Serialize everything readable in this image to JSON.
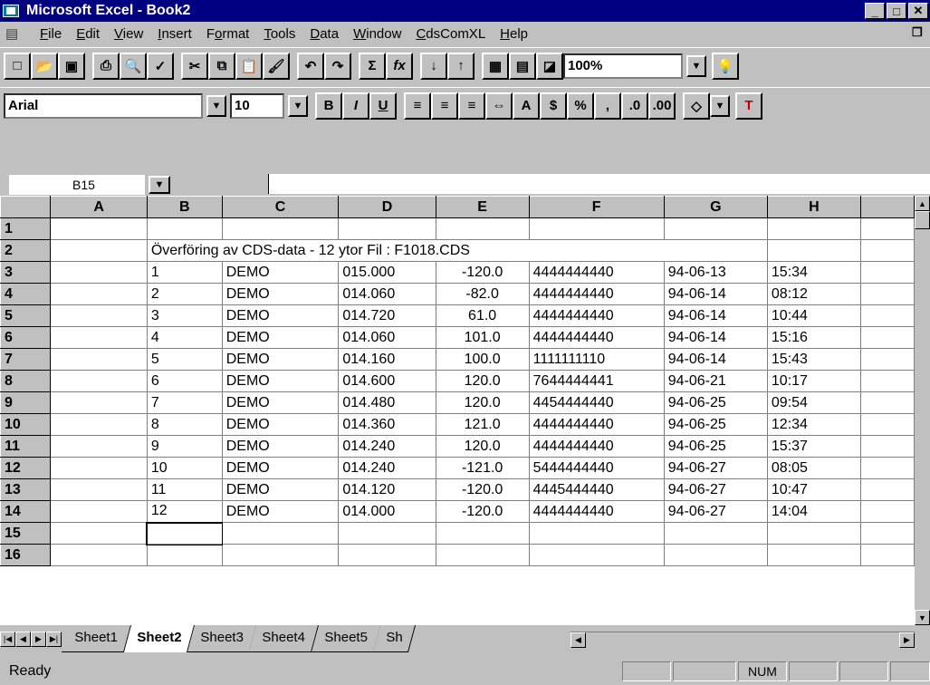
{
  "window": {
    "title": "Microsoft Excel - Book2",
    "buttons": [
      "_",
      "□",
      "✕"
    ]
  },
  "menu": [
    {
      "label": "File",
      "u": "F",
      "rest": "ile"
    },
    {
      "label": "Edit",
      "u": "E",
      "rest": "dit"
    },
    {
      "label": "View",
      "u": "V",
      "rest": "iew"
    },
    {
      "label": "Insert",
      "u": "I",
      "rest": "nsert"
    },
    {
      "label": "Format",
      "pre": "F",
      "u": "o",
      "rest": "rmat"
    },
    {
      "label": "Tools",
      "u": "T",
      "rest": "ools"
    },
    {
      "label": "Data",
      "u": "D",
      "rest": "ata"
    },
    {
      "label": "Window",
      "u": "W",
      "rest": "indow"
    },
    {
      "label": "CdsComXL",
      "u": "C",
      "rest": "dsComXL"
    },
    {
      "label": "Help",
      "u": "H",
      "rest": "elp"
    }
  ],
  "toolbar_standard": {
    "zoom": "100%",
    "icons": [
      "new-icon",
      "open-icon",
      "save-icon",
      "print-icon",
      "print-preview-icon",
      "spelling-icon",
      "cut-icon",
      "copy-icon",
      "paste-icon",
      "format-painter-icon",
      "undo-icon",
      "redo-icon",
      "autosum-icon",
      "function-wizard-icon",
      "sort-ascending-icon",
      "sort-descending-icon",
      "chart-wizard-icon",
      "text-box-icon",
      "drawing-icon",
      "tip-wizard-icon"
    ]
  },
  "toolbar_formatting": {
    "font": "Arial",
    "size": "10",
    "buttons": [
      "B",
      "I",
      "U",
      "%",
      ","
    ]
  },
  "formula_bar": {
    "name_box": "B15",
    "formula": ""
  },
  "columns": [
    "A",
    "B",
    "C",
    "D",
    "E",
    "F",
    "G",
    "H"
  ],
  "header_row_text": "Överföring av CDS-data - 12 ytor    Fil :  F1018.CDS",
  "rows": [
    {
      "n": "1",
      "cells": [
        "",
        "",
        "",
        "",
        "",
        "",
        "",
        ""
      ]
    },
    {
      "n": "2",
      "cells": [
        "",
        "",
        "",
        "",
        "",
        "",
        "",
        ""
      ]
    },
    {
      "n": "3",
      "cells": [
        "",
        "1",
        "DEMO",
        "015.000",
        "-120.0",
        "4444444440",
        "94-06-13",
        "15:34"
      ]
    },
    {
      "n": "4",
      "cells": [
        "",
        "2",
        "DEMO",
        "014.060",
        "-82.0",
        "4444444440",
        "94-06-14",
        "08:12"
      ]
    },
    {
      "n": "5",
      "cells": [
        "",
        "3",
        "DEMO",
        "014.720",
        "61.0",
        "4444444440",
        "94-06-14",
        "10:44"
      ]
    },
    {
      "n": "6",
      "cells": [
        "",
        "4",
        "DEMO",
        "014.060",
        "101.0",
        "4444444440",
        "94-06-14",
        "15:16"
      ]
    },
    {
      "n": "7",
      "cells": [
        "",
        "5",
        "DEMO",
        "014.160",
        "100.0",
        "1111111110",
        "94-06-14",
        "15:43"
      ]
    },
    {
      "n": "8",
      "cells": [
        "",
        "6",
        "DEMO",
        "014.600",
        "120.0",
        "7644444441",
        "94-06-21",
        "10:17"
      ]
    },
    {
      "n": "9",
      "cells": [
        "",
        "7",
        "DEMO",
        "014.480",
        "120.0",
        "4454444440",
        "94-06-25",
        "09:54"
      ]
    },
    {
      "n": "10",
      "cells": [
        "",
        "8",
        "DEMO",
        "014.360",
        "121.0",
        "4444444440",
        "94-06-25",
        "12:34"
      ]
    },
    {
      "n": "11",
      "cells": [
        "",
        "9",
        "DEMO",
        "014.240",
        "120.0",
        "4444444440",
        "94-06-25",
        "15:37"
      ]
    },
    {
      "n": "12",
      "cells": [
        "",
        "10",
        "DEMO",
        "014.240",
        "-121.0",
        "5444444440",
        "94-06-27",
        "08:05"
      ]
    },
    {
      "n": "13",
      "cells": [
        "",
        "11",
        "DEMO",
        "014.120",
        "-120.0",
        "4445444440",
        "94-06-27",
        "10:47"
      ]
    },
    {
      "n": "14",
      "cells": [
        "",
        "12",
        "DEMO",
        "014.000",
        "-120.0",
        "4444444440",
        "94-06-27",
        "14:04"
      ]
    },
    {
      "n": "15",
      "cells": [
        "",
        "",
        "",
        "",
        "",
        "",
        "",
        ""
      ]
    },
    {
      "n": "16",
      "cells": [
        "",
        "",
        "",
        "",
        "",
        "",
        "",
        ""
      ]
    }
  ],
  "sheet_tabs": [
    "Sheet1",
    "Sheet2",
    "Sheet3",
    "Sheet4",
    "Sheet5",
    "Sh"
  ],
  "active_sheet": "Sheet2",
  "status": {
    "text": "Ready",
    "panes": [
      "",
      "",
      "NUM",
      "",
      "",
      ""
    ]
  }
}
